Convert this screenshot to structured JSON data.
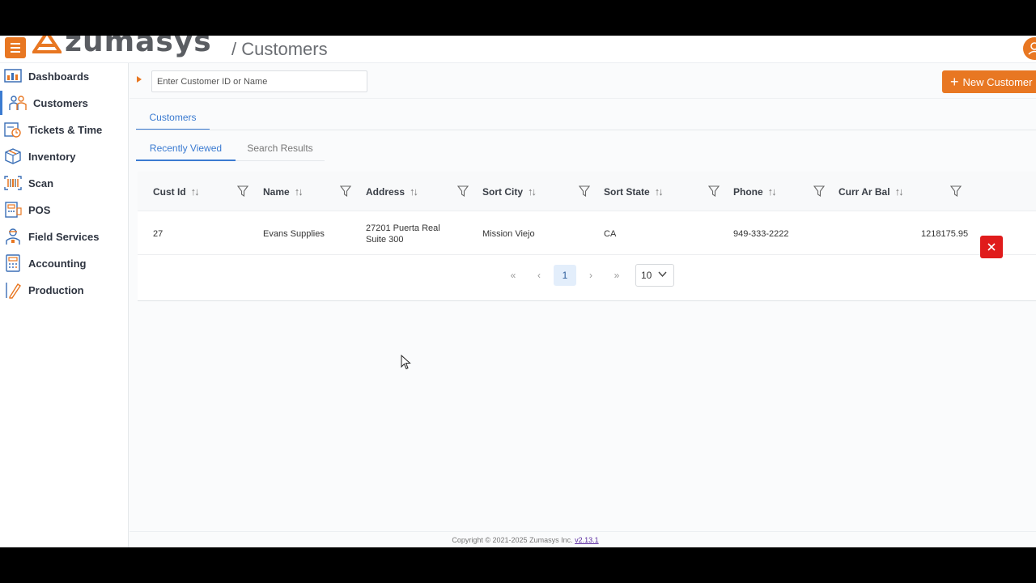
{
  "header": {
    "logo_text": "zumasys",
    "breadcrumb": "/ Customers"
  },
  "sidebar": {
    "items": [
      {
        "label": "Dashboards",
        "icon": "dashboard-icon"
      },
      {
        "label": "Customers",
        "icon": "customers-icon"
      },
      {
        "label": "Tickets & Time",
        "icon": "tickets-icon"
      },
      {
        "label": "Inventory",
        "icon": "inventory-icon"
      },
      {
        "label": "Scan",
        "icon": "barcode-icon"
      },
      {
        "label": "POS",
        "icon": "pos-icon"
      },
      {
        "label": "Field Services",
        "icon": "field-services-icon"
      },
      {
        "label": "Accounting",
        "icon": "accounting-icon"
      },
      {
        "label": "Production",
        "icon": "production-icon"
      }
    ]
  },
  "search": {
    "placeholder": "Enter Customer ID or Name",
    "value": ""
  },
  "toolbar": {
    "new_customer_label": "New Customer"
  },
  "tabs": {
    "main": "Customers",
    "sub": [
      "Recently Viewed",
      "Search Results"
    ]
  },
  "table": {
    "columns": [
      "Cust Id",
      "Name",
      "Address",
      "Sort City",
      "Sort State",
      "Phone",
      "Curr Ar Bal"
    ],
    "rows": [
      {
        "cust_id": "27",
        "name": "Evans Supplies",
        "address_line1": "27201 Puerta Real",
        "address_line2": "Suite 300",
        "city": "Mission Viejo",
        "state": "CA",
        "phone": "949-333-2222",
        "balance": "1218175.95"
      }
    ]
  },
  "pagination": {
    "current_page": "1",
    "page_size": "10"
  },
  "footer": {
    "copyright": "Copyright © 2021-2025 Zumasys Inc.",
    "version": "v2.13.1"
  },
  "colors": {
    "accent": "#e87722",
    "link": "#3b7bd1",
    "danger": "#e01c1c"
  }
}
